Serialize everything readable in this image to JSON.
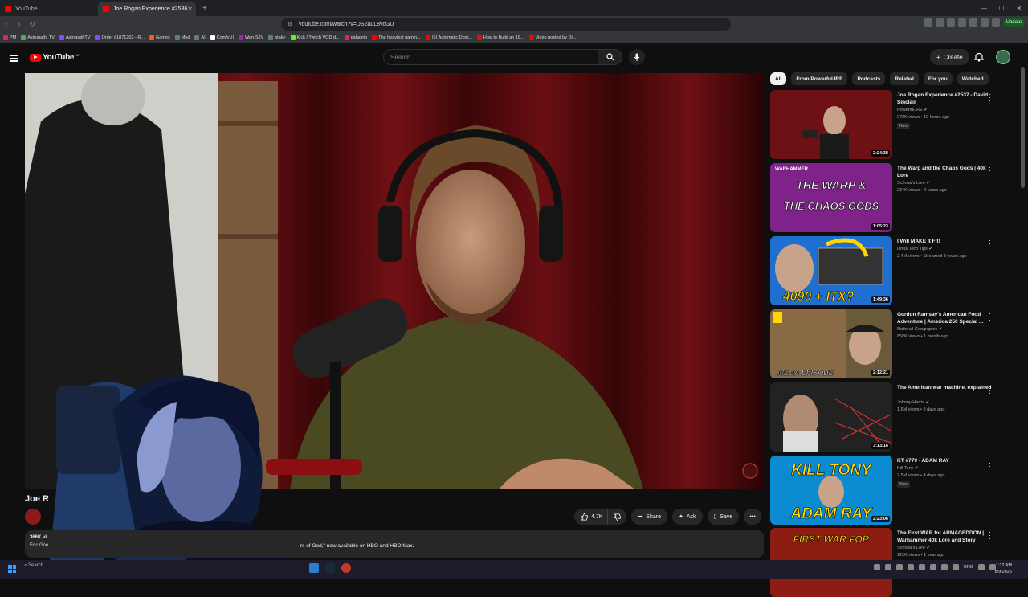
{
  "browser": {
    "tabs": [
      {
        "title": "YouTube",
        "active": false
      },
      {
        "title": "Joe Rogan Experience #2536",
        "active": true
      }
    ],
    "url": "youtube.com/watch?v=DS2aLL8ycGU",
    "update_label": "Update",
    "bookmarks": [
      "PM",
      "Astropath_TV",
      "AstropathTV",
      "Order #1871203 - R...",
      "Games",
      "Mod",
      "AI",
      "ComfyUI",
      "Wan-S2V",
      "stake",
      "Kick / Twitch VOD d...",
      "palacejo",
      "The heaviest gamin...",
      "(5) Automatic Door...",
      "How to Build an 18...",
      "Video posted by Di..."
    ]
  },
  "youtube": {
    "logo_text": "YouTube",
    "logo_country": "NZ",
    "search_placeholder": "Search",
    "create_label": "Create"
  },
  "video": {
    "title_partial": "Joe R",
    "actions": {
      "like_count": "4.7K",
      "share": "Share",
      "ask": "Ask",
      "save": "Save"
    },
    "description": {
      "views_partial": "366K vi",
      "channel_partial": "Eric Goo",
      "snippet": "rs of God,\" now available on HBO and HBO Max."
    }
  },
  "chips": [
    "All",
    "From PowerfulJRE",
    "Podcasts",
    "Related",
    "For you",
    "Watched"
  ],
  "recommendations": [
    {
      "title": "Joe Rogan Experience #2537 - David Sinclair",
      "channel": "PowerfulJRE",
      "meta": "276K views • 19 hours ago",
      "badge": "New",
      "duration": "2:24:38"
    },
    {
      "title": "The Warp and the Chaos Gods | 40k Lore",
      "channel": "Scholar's Lore",
      "meta": "234K views • 2 years ago",
      "badge": "",
      "duration": "1:05:23",
      "thumb_text1": "THE WARP &",
      "thumb_text2": "THE CHAOS GODS",
      "thumb_tag": "WARHAMMER"
    },
    {
      "title": "I Will MAKE It Fit!",
      "channel": "Linus Tech Tips",
      "meta": "2.4M views • Streamed 3 years ago",
      "badge": "",
      "duration": "1:49:36",
      "thumb_text1": "4090 + ITX?"
    },
    {
      "title": "Gordon Ramsay's American Food Adventure | America 250 Special ...",
      "channel": "National Geographic",
      "meta": "858K views • 1 month ago",
      "badge": "",
      "duration": "2:12:21",
      "thumb_text1": "MEGA EPISODE"
    },
    {
      "title": "The American war machine, explained",
      "channel": "Johnny Harris",
      "meta": "1.6M views • 9 days ago",
      "badge": "",
      "duration": "3:13:16"
    },
    {
      "title": "KT #779 - ADAM RAY",
      "channel": "Kill Tony",
      "meta": "2.5M views • 4 days ago",
      "badge": "New",
      "duration": "2:23:06",
      "thumb_text1": "KILL TONY",
      "thumb_text2": "ADAM RAY"
    },
    {
      "title": "The First WAR for ARMAGEDDON | Warhammer 40k Lore and Story",
      "channel": "Scholar's Lore",
      "meta": "123K views • 1 year ago",
      "badge": "",
      "duration": "",
      "thumb_text1": "FIRST WAR FOR"
    }
  ],
  "taskbar": {
    "search_label": "Search",
    "lang": "ENG",
    "time": "1:32 AM",
    "date": "8/9/2026"
  }
}
